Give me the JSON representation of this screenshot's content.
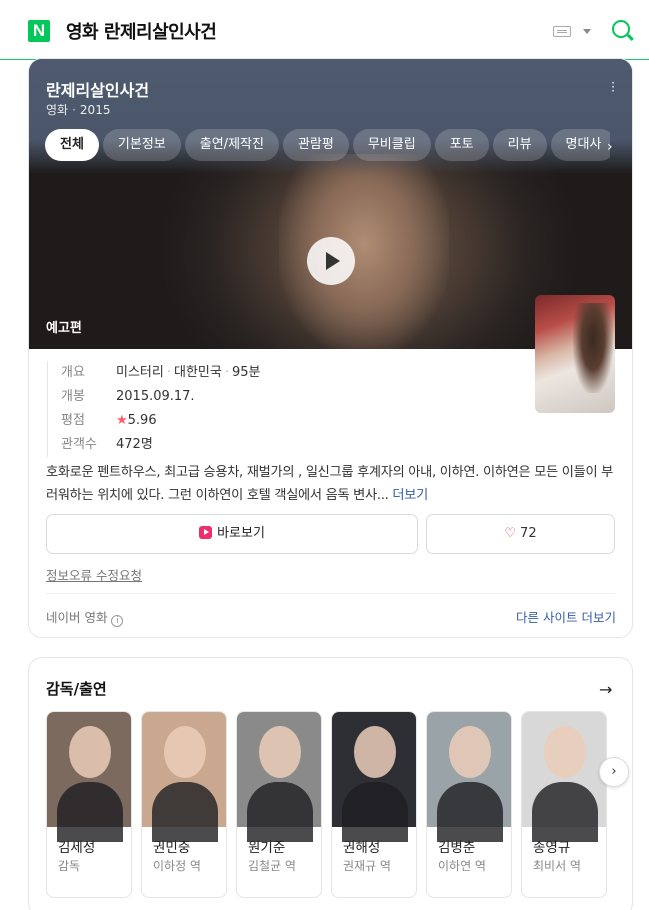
{
  "header": {
    "logo_letter": "N",
    "query": "영화 란제리살인사건"
  },
  "movie": {
    "title": "란제리살인사건",
    "category": "영화",
    "year": "2015",
    "trailer_label": "예고편",
    "tabs": [
      {
        "label": "전체",
        "active": true
      },
      {
        "label": "기본정보",
        "active": false
      },
      {
        "label": "출연/제작진",
        "active": false
      },
      {
        "label": "관람평",
        "active": false
      },
      {
        "label": "무비클립",
        "active": false
      },
      {
        "label": "포토",
        "active": false
      },
      {
        "label": "리뷰",
        "active": false
      },
      {
        "label": "명대사",
        "active": false
      }
    ],
    "facts": {
      "overview_key": "개요",
      "genre": "미스터리",
      "country": "대한민국",
      "runtime": "95분",
      "release_key": "개봉",
      "release_date": "2015.09.17.",
      "rating_key": "평점",
      "rating": "5.96",
      "audience_key": "관객수",
      "audience": "472명"
    },
    "synopsis": "호화로운 펜트하우스, 최고급 승용차, 재벌가의 , 일신그룹 후계자의 아내, 이하연. 이하연은 모든 이들이 부러워하는 위치에 있다. 그런 이하연이 호텔 객실에서 음독 변사...",
    "synopsis_more": "더보기",
    "watch_label": "바로보기",
    "like_count": "72",
    "report_link": "정보오류 수정요청",
    "source": "네이버 영화",
    "other_sites": "다른 사이트 더보기"
  },
  "cast": {
    "title": "감독/출연",
    "people": [
      {
        "name": "김세성",
        "role": "감독",
        "color": "#7c6a5e"
      },
      {
        "name": "권민중",
        "role": "이하정 역",
        "color": "#c9a88f"
      },
      {
        "name": "원기준",
        "role": "김철균 역",
        "color": "#8a8a8a"
      },
      {
        "name": "권해성",
        "role": "권재규 역",
        "color": "#2e2f35"
      },
      {
        "name": "김병춘",
        "role": "이하연 역",
        "color": "#9aa3a8"
      },
      {
        "name": "송영규",
        "role": "최비서 역",
        "color": "#d8d8d8"
      }
    ]
  },
  "colors": {
    "brand_green": "#03c75a",
    "link_blue": "#355daa",
    "star_red": "#ff5b6c"
  }
}
